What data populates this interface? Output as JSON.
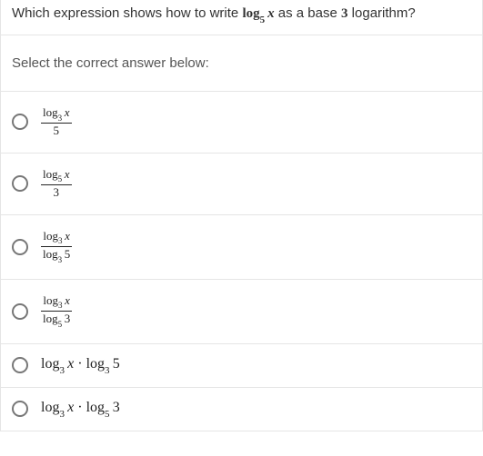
{
  "question": {
    "prefix": "Which expression shows how to write ",
    "log_label": "log",
    "log_sub": "5",
    "log_arg": "x",
    "middle": " as a base ",
    "base": "3",
    "suffix": " logarithm?"
  },
  "prompt": "Select the correct answer below:",
  "options": [
    {
      "type": "frac",
      "num_log": "log",
      "num_sub": "3",
      "num_arg": "x",
      "den_plain": "5"
    },
    {
      "type": "frac",
      "num_log": "log",
      "num_sub": "5",
      "num_arg": "x",
      "den_plain": "3"
    },
    {
      "type": "frac",
      "num_log": "log",
      "num_sub": "3",
      "num_arg": "x",
      "den_log": "log",
      "den_sub": "3",
      "den_arg": "5"
    },
    {
      "type": "frac",
      "num_log": "log",
      "num_sub": "3",
      "num_arg": "x",
      "den_log": "log",
      "den_sub": "5",
      "den_arg": "3"
    },
    {
      "type": "prod",
      "a_log": "log",
      "a_sub": "3",
      "a_arg": "x",
      "b_log": "log",
      "b_sub": "3",
      "b_arg": "5"
    },
    {
      "type": "prod",
      "a_log": "log",
      "a_sub": "3",
      "a_arg": "x",
      "b_log": "log",
      "b_sub": "5",
      "b_arg": "3"
    }
  ]
}
